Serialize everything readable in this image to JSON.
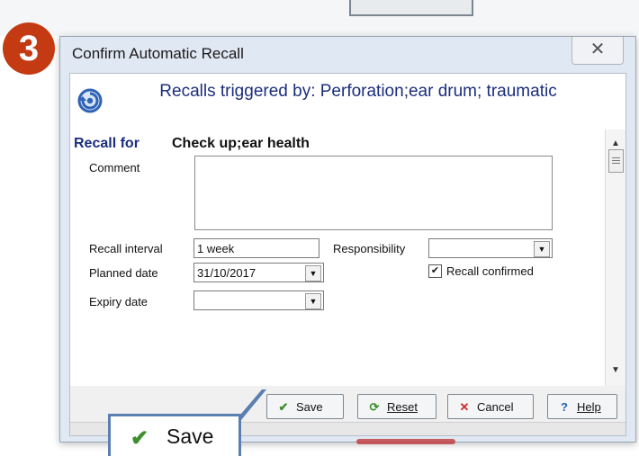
{
  "step_number": "3",
  "dialog": {
    "title": "Confirm Automatic Recall",
    "close_symbol": "✕",
    "header_text": "Recalls triggered by: Perforation;ear drum; traumatic",
    "recall_for_label": "Recall for",
    "recall_for_value": "Check up;ear health",
    "comment_label": "Comment",
    "comment_value": "",
    "recall_interval_label": "Recall interval",
    "recall_interval_value": "1 week",
    "responsibility_label": "Responsibility",
    "responsibility_value": "",
    "planned_date_label": "Planned date",
    "planned_date_value": "31/10/2017",
    "expiry_date_label": "Expiry date",
    "expiry_date_value": "",
    "recall_confirmed_label": "Recall confirmed",
    "recall_confirmed_checked": true
  },
  "buttons": {
    "save": "Save",
    "reset": "Reset",
    "cancel": "Cancel",
    "help": "Help"
  },
  "callout": {
    "label": "Save"
  },
  "icons": {
    "logo": "recall-logo-icon",
    "save": "checkmark-icon",
    "reset": "refresh-icon",
    "cancel": "x-icon",
    "help": "question-icon"
  },
  "colors": {
    "badge": "#c43a12",
    "heading_text": "#1b2d7c",
    "save_check": "#3e8f2e",
    "cancel_x": "#d12a2a",
    "help_blue": "#1f5fb8",
    "callout_border": "#5b7fb0"
  }
}
